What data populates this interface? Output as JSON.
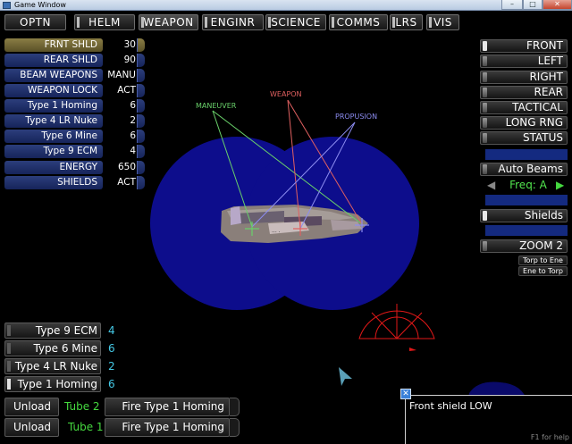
{
  "window": {
    "title": "Game Window",
    "minimize": "–",
    "maximize": "□",
    "close": "✕"
  },
  "tabs": [
    {
      "label": "OPTN",
      "selected": false
    },
    {
      "label": "HELM",
      "selected": false
    },
    {
      "label": "WEAPON",
      "selected": true
    },
    {
      "label": "ENGINR",
      "selected": false
    },
    {
      "label": "SCIENCE",
      "selected": false
    },
    {
      "label": "COMMS",
      "selected": false
    },
    {
      "label": "LRS",
      "selected": false
    },
    {
      "label": "VIS",
      "selected": false
    }
  ],
  "stats": [
    {
      "label": "FRNT SHLD",
      "value": "30",
      "highlight": true
    },
    {
      "label": "REAR SHLD",
      "value": "90"
    },
    {
      "label": "BEAM WEAPONS",
      "value": "MANU"
    },
    {
      "label": "WEAPON LOCK",
      "value": "ACT"
    },
    {
      "label": "Type 1 Homing",
      "value": "6"
    },
    {
      "label": "Type 4 LR Nuke",
      "value": "2"
    },
    {
      "label": "Type 6 Mine",
      "value": "6"
    },
    {
      "label": "Type 9 ECM",
      "value": "4"
    },
    {
      "label": "ENERGY",
      "value": "650"
    },
    {
      "label": "SHIELDS",
      "value": "ACT"
    }
  ],
  "views": [
    {
      "label": "FRONT",
      "active": true
    },
    {
      "label": "LEFT"
    },
    {
      "label": "RIGHT"
    },
    {
      "label": "REAR"
    },
    {
      "label": "TACTICAL"
    },
    {
      "label": "LONG RNG"
    },
    {
      "label": "STATUS"
    }
  ],
  "beams": {
    "auto_label": "Auto Beams",
    "freq_label": "Freq: A",
    "prev": "◀",
    "next": "▶"
  },
  "shields_label": "Shields",
  "zoom_label": "ZOOM 2",
  "transfer": {
    "torp_to_ene": "Torp to Ene",
    "ene_to_torp": "Ene to Torp"
  },
  "ordnance": [
    {
      "label": "Type 9 ECM",
      "count": "4",
      "active": false
    },
    {
      "label": "Type 6 Mine",
      "count": "6",
      "active": false
    },
    {
      "label": "Type 4 LR Nuke",
      "count": "2",
      "active": false
    },
    {
      "label": "Type 1 Homing",
      "count": "6",
      "active": true
    }
  ],
  "tubes": [
    {
      "unload": "Unload",
      "tube": "Tube 2",
      "fire": "Fire Type 1 Homing"
    },
    {
      "unload": "Unload",
      "tube": "Tube 1",
      "fire": "Fire Type 1 Homing"
    }
  ],
  "targeting": {
    "maneuver": "MANEUVER",
    "weapon": "WEAPON",
    "propulsion": "PROPUSION"
  },
  "message": {
    "text": "Front shield LOW",
    "help": "F1 for help",
    "close": "✕"
  },
  "colors": {
    "shield": "#0d0d8c",
    "maneuver": "#69d06a",
    "weapon": "#e06060",
    "propulsion": "#8c8cf0",
    "radar": "#e01818",
    "count": "#44c9e6",
    "green": "#45d93f"
  }
}
